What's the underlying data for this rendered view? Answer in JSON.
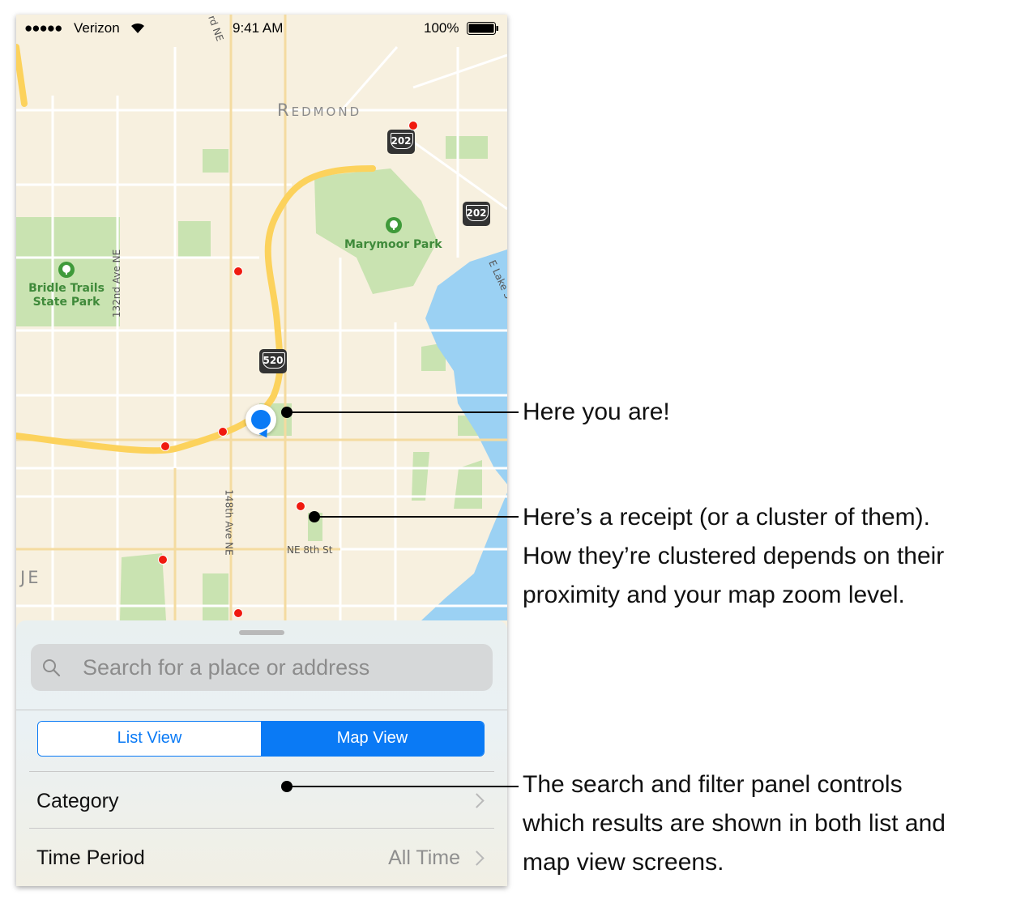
{
  "status_bar": {
    "signal": "●●●●●",
    "carrier": "Verizon",
    "time": "9:41 AM",
    "battery": "100%"
  },
  "map": {
    "city_label": "Redmond",
    "parks": [
      "Marymoor Park",
      "Bridle Trails State Park"
    ],
    "roads": [
      "132nd Ave NE",
      "148th Ave NE",
      "NE 8th St",
      "E Lake S",
      "rd NE"
    ],
    "city_edge_label": "JE",
    "shields": [
      "202",
      "202",
      "520"
    ],
    "pin_color": "#f01a0f",
    "location_color": "#0a7af5"
  },
  "panel": {
    "search_placeholder": "Search for a place or address",
    "segments": {
      "list": "List View",
      "map": "Map View",
      "selected": "Map View"
    },
    "rows": [
      {
        "label": "Category",
        "value": ""
      },
      {
        "label": "Time Period",
        "value": "All Time"
      }
    ],
    "accent_color": "#0a7af5"
  },
  "annotations": {
    "location": "Here you are!",
    "receipt": [
      "Here’s a receipt (or a cluster of them).",
      "How they’re clustered depends on their",
      "proximity and your map zoom level."
    ],
    "panel": [
      "The search and filter panel controls",
      "which results are shown in both list and",
      "map view screens."
    ]
  }
}
